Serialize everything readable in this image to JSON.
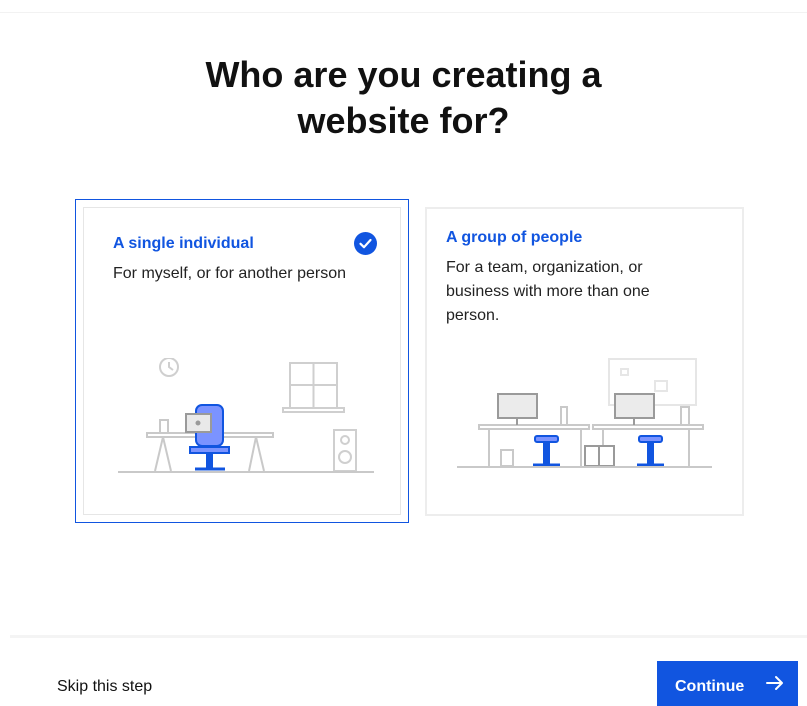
{
  "heading": {
    "line1": "Who are you creating a",
    "line2": "website for?"
  },
  "options": [
    {
      "title": "A single individual",
      "description": "For myself, or for another person",
      "selected": true
    },
    {
      "title": "A group of people",
      "description": "For a team, organization, or business with more than one person.",
      "selected": false
    }
  ],
  "footer": {
    "skip_label": "Skip this step",
    "continue_label": "Continue"
  },
  "colors": {
    "accent": "#1155e0",
    "line": "#c9c9c9"
  },
  "icons": [
    "checkmark-icon",
    "arrow-right-icon",
    "clock-icon",
    "window-icon",
    "speaker-icon",
    "laptop-icon",
    "office-chair-icon",
    "monitor-icon",
    "stool-icon"
  ]
}
